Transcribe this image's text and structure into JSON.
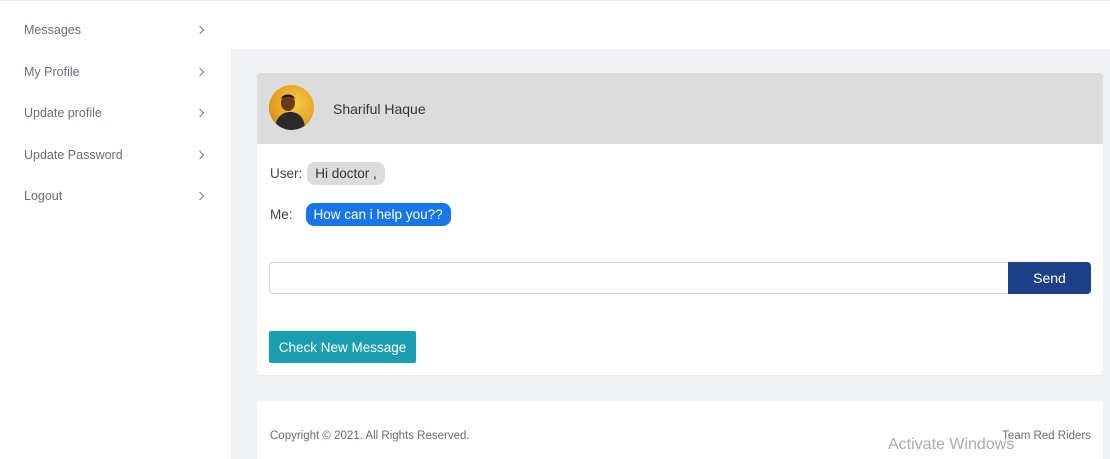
{
  "sidebar": {
    "items": [
      {
        "label": "Messages"
      },
      {
        "label": "My Profile"
      },
      {
        "label": "Update profile"
      },
      {
        "label": "Update Password"
      },
      {
        "label": "Logout"
      }
    ]
  },
  "chat": {
    "contact_name": "Shariful Haque",
    "messages": [
      {
        "prefix": "User:",
        "text": "Hi doctor ,",
        "sender": "user"
      },
      {
        "prefix": "Me:",
        "text": "How can i help you??",
        "sender": "me"
      }
    ],
    "input_value": "",
    "input_placeholder": "",
    "send_label": "Send",
    "check_label": "Check New Message"
  },
  "footer": {
    "copyright": "Copyright © 2021. All Rights Reserved.",
    "team": "Team Red Riders"
  },
  "watermark": "Activate Windows",
  "colors": {
    "send_button": "#1d3f87",
    "check_button": "#1a9dae",
    "me_bubble": "#1877e8",
    "user_bubble": "#dcdcdc",
    "header_bg": "#dcdcdc"
  }
}
